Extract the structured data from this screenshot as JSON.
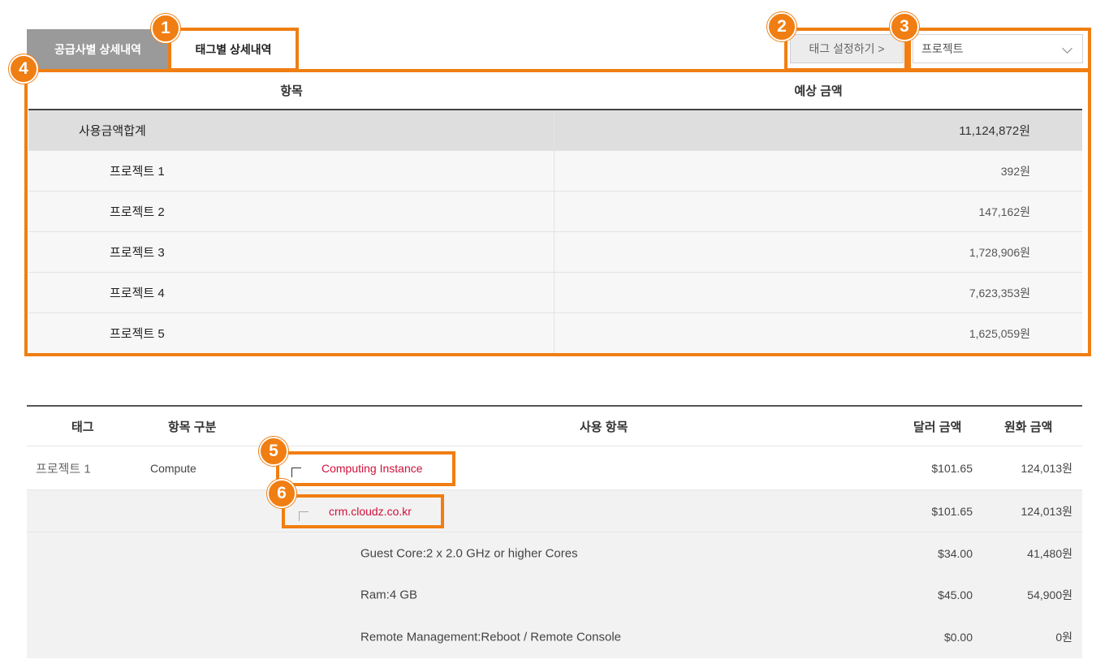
{
  "tabs": {
    "supplier_label": "공급사별 상세내역",
    "tag_label": "태그별 상세내역"
  },
  "toolbar": {
    "tag_settings_label": "태그 설정하기 >",
    "select_value": "프로젝트"
  },
  "badges": [
    "1",
    "2",
    "3",
    "4",
    "5",
    "6"
  ],
  "summary": {
    "headers": {
      "item": "항목",
      "amount": "예상 금액"
    },
    "total": {
      "label": "사용금액합계",
      "amount": "11,124,872원"
    },
    "rows": [
      {
        "label": "프로젝트 1",
        "amount": "392원"
      },
      {
        "label": "프로젝트 2",
        "amount": "147,162원"
      },
      {
        "label": "프로젝트 3",
        "amount": "1,728,906원"
      },
      {
        "label": "프로젝트 4",
        "amount": "7,623,353원"
      },
      {
        "label": "프로젝트 5",
        "amount": "1,625,059원"
      }
    ]
  },
  "detail": {
    "headers": {
      "tag": "태그",
      "category": "항목 구분",
      "usage": "사용 항목",
      "usd": "달러 금액",
      "krw": "원화 금액"
    },
    "main_row": {
      "tag": "프로젝트 1",
      "category": "Compute",
      "usage": "Computing Instance",
      "usd": "$101.65",
      "krw": "124,013원"
    },
    "host_row": {
      "usage": "crm.cloudz.co.kr",
      "usd": "$101.65",
      "krw": "124,013원"
    },
    "spec_rows": [
      {
        "usage": "Guest Core:2 x 2.0 GHz or higher Cores",
        "usd": "$34.00",
        "krw": "41,480원"
      },
      {
        "usage": "Ram:4 GB",
        "usd": "$45.00",
        "krw": "54,900원"
      },
      {
        "usage": "Remote Management:Reboot / Remote Console",
        "usd": "$0.00",
        "krw": "0원"
      }
    ]
  },
  "colors": {
    "highlight": "#f07e12",
    "link_red": "#d0103a",
    "tab_inactive": "#9a9a9a"
  }
}
